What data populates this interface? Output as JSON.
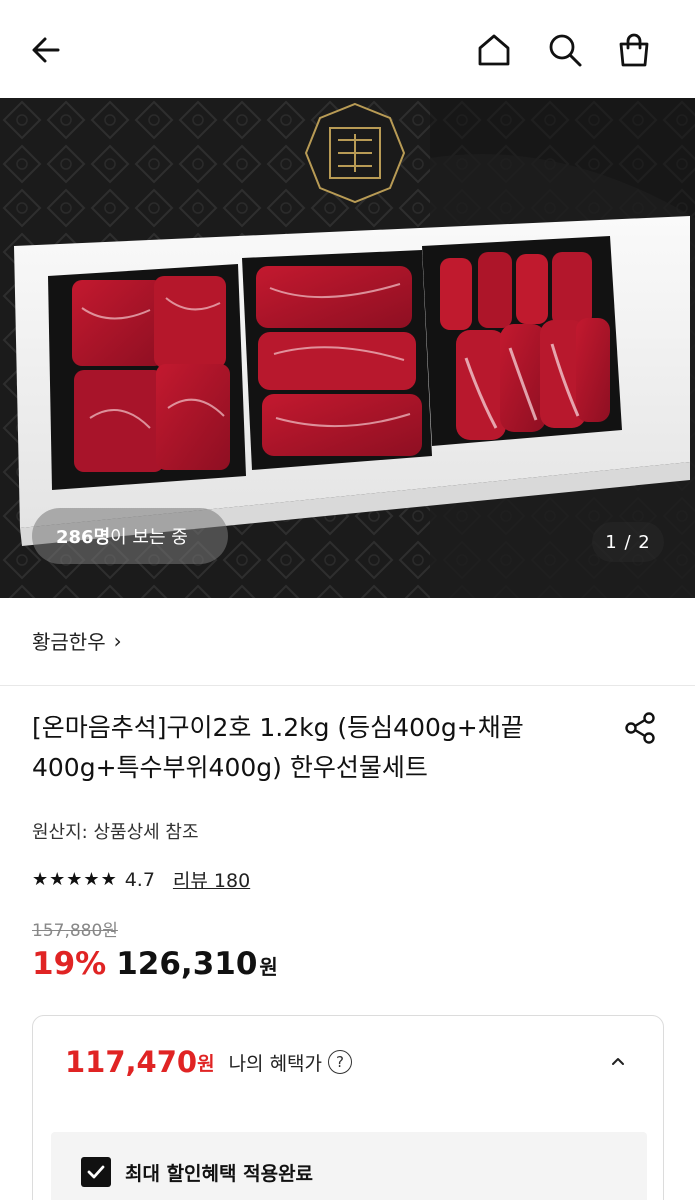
{
  "header": {
    "back_icon": "arrow-left-icon",
    "home_icon": "home-icon",
    "search_icon": "search-icon",
    "cart_icon": "shopping-bag-icon"
  },
  "hero": {
    "viewers_count": "286명",
    "viewers_suffix": "이 보는 중",
    "pager": "1 / 2"
  },
  "brand": {
    "name": "황금한우",
    "chevron": "›"
  },
  "product": {
    "title": "[온마음추석]구이2호 1.2kg (등심400g+채끝400g+특수부위400g) 한우선물세트",
    "origin": "원산지: 상품상세 참조",
    "rating_score": "4.7",
    "review_label": "리뷰 180",
    "rating_value": 4.7,
    "original_price": "157,880원",
    "discount": "19%",
    "price": "126,310",
    "price_unit": "원"
  },
  "benefit": {
    "price": "117,470",
    "unit": "원",
    "label": "나의 혜택가",
    "help_icon": "?",
    "applied_label": "최대 할인혜택 적용완료"
  },
  "colors": {
    "accent_red": "#e02424",
    "text": "#111111",
    "muted": "#888888"
  }
}
